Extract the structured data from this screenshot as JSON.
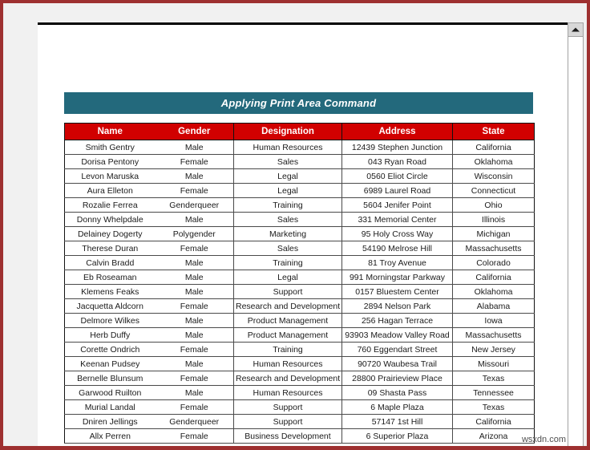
{
  "window": {
    "watermark": "wsxdn.com"
  },
  "scrollbar": {
    "up_arrow_icon": "triangle-up-icon"
  },
  "document": {
    "title_banner": "Applying Print Area Command",
    "table": {
      "columns": [
        "Name",
        "Gender",
        "Designation",
        "Address",
        "State"
      ],
      "rows": [
        [
          "Smith Gentry",
          "Male",
          "Human Resources",
          "12439 Stephen Junction",
          "California"
        ],
        [
          "Dorisa Pentony",
          "Female",
          "Sales",
          "043 Ryan Road",
          "Oklahoma"
        ],
        [
          "Levon Maruska",
          "Male",
          "Legal",
          "0560 Eliot Circle",
          "Wisconsin"
        ],
        [
          "Aura Elleton",
          "Female",
          "Legal",
          "6989 Laurel Road",
          "Connecticut"
        ],
        [
          "Rozalie Ferrea",
          "Genderqueer",
          "Training",
          "5604 Jenifer Point",
          "Ohio"
        ],
        [
          "Donny Whelpdale",
          "Male",
          "Sales",
          "331 Memorial Center",
          "Illinois"
        ],
        [
          "Delainey Dogerty",
          "Polygender",
          "Marketing",
          "95 Holy Cross Way",
          "Michigan"
        ],
        [
          "Therese Duran",
          "Female",
          "Sales",
          "54190 Melrose Hill",
          "Massachusetts"
        ],
        [
          "Calvin Bradd",
          "Male",
          "Training",
          "81 Troy Avenue",
          "Colorado"
        ],
        [
          "Eb Roseaman",
          "Male",
          "Legal",
          "991 Morningstar Parkway",
          "California"
        ],
        [
          "Klemens Feaks",
          "Male",
          "Support",
          "0157 Bluestem Center",
          "Oklahoma"
        ],
        [
          "Jacquetta Aldcorn",
          "Female",
          "Research and Development",
          "2894 Nelson Park",
          "Alabama"
        ],
        [
          "Delmore Wilkes",
          "Male",
          "Product Management",
          "256 Hagan Terrace",
          "Iowa"
        ],
        [
          "Herb Duffy",
          "Male",
          "Product Management",
          "93903 Meadow Valley Road",
          "Massachusetts"
        ],
        [
          "Corette Ondrich",
          "Female",
          "Training",
          "760 Eggendart Street",
          "New Jersey"
        ],
        [
          "Keenan Pudsey",
          "Male",
          "Human Resources",
          "90720 Waubesa Trail",
          "Missouri"
        ],
        [
          "Bernelle Blunsum",
          "Female",
          "Research and Development",
          "28800 Prairieview Place",
          "Texas"
        ],
        [
          "Garwood Ruilton",
          "Male",
          "Human Resources",
          "09 Shasta Pass",
          "Tennessee"
        ],
        [
          "Murial Landal",
          "Female",
          "Support",
          "6 Maple Plaza",
          "Texas"
        ],
        [
          "Dniren Jellings",
          "Genderqueer",
          "Support",
          "57147 1st Hill",
          "California"
        ],
        [
          "Allx Perren",
          "Female",
          "Business Development",
          "6 Superior Plaza",
          "Arizona"
        ]
      ]
    }
  },
  "colors": {
    "banner_teal": "#23697c",
    "header_red": "#d10000",
    "window_border": "#9e3030",
    "margin_gray": "#f1f1f1"
  }
}
